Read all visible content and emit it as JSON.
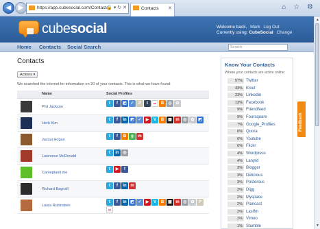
{
  "browser": {
    "url": "https://app.cubesocial.com/Contacts",
    "tab_title": "Contacts",
    "nav_back_glyph": "◀",
    "nav_fwd_glyph": "▶",
    "addr_controls": "🔒 ▾ ↻ ✕",
    "tab_close": "✕",
    "win_icons": "⌂ ☆ ⚙"
  },
  "header": {
    "logo_cube": "cube",
    "logo_social": "social",
    "welcome_prefix": "Welcome back,",
    "user_name": "Mark",
    "logout_label": "Log Out",
    "currently_using_label": "Currently using:",
    "current_app": "CubeSocial",
    "change_label": "Change"
  },
  "nav": {
    "items": [
      "Home",
      "Contacts",
      "Social Search"
    ],
    "search_placeholder": "Search"
  },
  "main": {
    "title": "Contacts",
    "actions_label": "Actions ▾",
    "intro": "We searched the internet for information on 20 of your contacts. This is what we have found:",
    "col_name": "Name",
    "col_profiles": "Social Profiles",
    "contacts": [
      {
        "name": "Phil Jackson",
        "avatar_color": "#3a3a3a",
        "icons": [
          "twitter",
          "facebook",
          "delicious",
          "friendfeed",
          "posterous",
          "tumblr",
          "flickr",
          "blogger",
          "misc",
          "misc2"
        ]
      },
      {
        "name": "Herb Kim",
        "avatar_color": "#1e2f55",
        "icons": [
          "twitter",
          "facebook",
          "linkedin",
          "delicious",
          "friendfeed",
          "youtube",
          "vimeo",
          "blogger",
          "lastfm",
          "myspace",
          "misc",
          "misc2",
          "delicious"
        ]
      },
      {
        "name": "Jacqui Hogan",
        "avatar_color": "#8a5a2e",
        "icons": [
          "twitter",
          "facebook",
          "blogger",
          "google",
          "myspace"
        ]
      },
      {
        "name": "Lawrence McDonald",
        "avatar_color": "#a13a28",
        "icons": [
          "twitter",
          "linkedin",
          "misc"
        ]
      },
      {
        "name": "Careeplanit me",
        "avatar_color": "#5fbf2a",
        "icons": [
          "twitter",
          "youtube",
          "facebook"
        ]
      },
      {
        "name": "Richard Bagnall",
        "avatar_color": "#2c2c2c",
        "icons": [
          "twitter",
          "facebook",
          "linkedin",
          "myspace"
        ]
      },
      {
        "name": "Laura Rubinstein",
        "avatar_color": "#b36a3d",
        "icons": [
          "twitter",
          "facebook",
          "linkedin",
          "delicious",
          "friendfeed",
          "youtube",
          "vimeo",
          "blogger",
          "lastfm",
          "myspace",
          "misc",
          "misc2",
          "posterous",
          "flickr"
        ]
      }
    ]
  },
  "panel": {
    "title": "Know Your Contacts",
    "subtitle": "Where your contacts are active online:",
    "items": [
      {
        "pct": "57%",
        "name": "Twitter"
      },
      {
        "pct": "43%",
        "name": "Klout"
      },
      {
        "pct": "23%",
        "name": "Linkedin"
      },
      {
        "pct": "13%",
        "name": "Facebook"
      },
      {
        "pct": "9%",
        "name": "Friendfeed"
      },
      {
        "pct": "9%",
        "name": "Foursquare"
      },
      {
        "pct": "7%",
        "name": "Google_Profiles"
      },
      {
        "pct": "6%",
        "name": "Quora"
      },
      {
        "pct": "6%",
        "name": "Youtube"
      },
      {
        "pct": "6%",
        "name": "Flickr"
      },
      {
        "pct": "4%",
        "name": "Wordpress"
      },
      {
        "pct": "4%",
        "name": "Lanyrd"
      },
      {
        "pct": "3%",
        "name": "Blogger"
      },
      {
        "pct": "3%",
        "name": "Delicious"
      },
      {
        "pct": "3%",
        "name": "Posterous"
      },
      {
        "pct": "2%",
        "name": "Digg"
      },
      {
        "pct": "2%",
        "name": "Myspace"
      },
      {
        "pct": "2%",
        "name": "Plancast"
      },
      {
        "pct": "2%",
        "name": "Lastfm"
      },
      {
        "pct": "2%",
        "name": "Vimeo"
      },
      {
        "pct": "1%",
        "name": "Stumble"
      }
    ]
  },
  "feedback_label": "Feedback",
  "icon_styles": {
    "twitter": {
      "bg": "#2aa9e0",
      "glyph": "t"
    },
    "facebook": {
      "bg": "#3b5998",
      "glyph": "f"
    },
    "linkedin": {
      "bg": "#0a66a8",
      "glyph": "in"
    },
    "delicious": {
      "bg": "#3274d1",
      "glyph": "◩"
    },
    "friendfeed": {
      "bg": "#5b8fd6",
      "glyph": "✓"
    },
    "posterous": {
      "bg": "#cfc9b8",
      "glyph": "P"
    },
    "tumblr": {
      "bg": "#35465c",
      "glyph": "t"
    },
    "flickr": {
      "bg": "#ffffff",
      "glyph": "••"
    },
    "blogger": {
      "bg": "#f57d00",
      "glyph": "B"
    },
    "youtube": {
      "bg": "#cc181e",
      "glyph": "▶"
    },
    "vimeo": {
      "bg": "#1ab7ea",
      "glyph": "V"
    },
    "lastfm": {
      "bg": "#1a1a1a",
      "glyph": "▦"
    },
    "myspace": {
      "bg": "#d0312d",
      "glyph": "m"
    },
    "google": {
      "bg": "#4caf50",
      "glyph": "g"
    },
    "misc": {
      "bg": "#9aa1a8",
      "glyph": "◎"
    },
    "misc2": {
      "bg": "#c8ccd0",
      "glyph": "✿"
    }
  }
}
